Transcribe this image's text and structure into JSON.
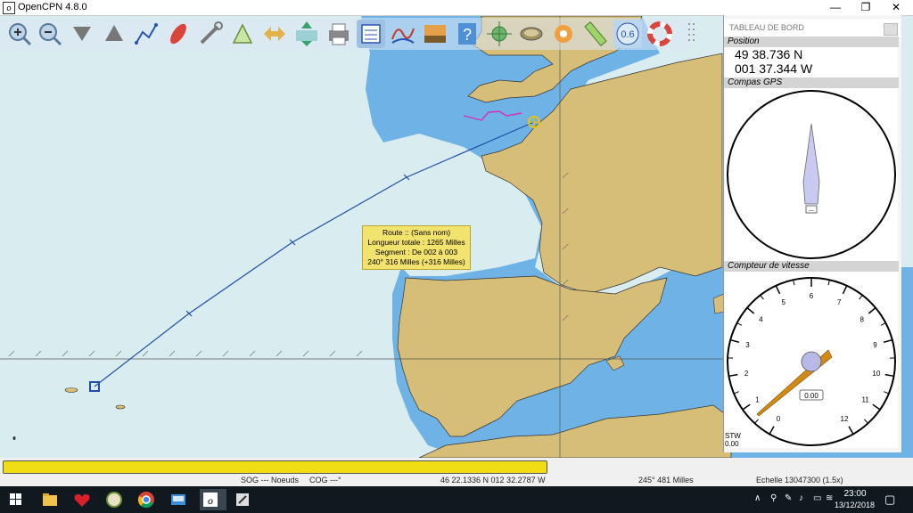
{
  "window": {
    "title": "OpenCPN 4.8.0",
    "min": "—",
    "restore": "❐",
    "close": "✕"
  },
  "toolbar": {
    "zoom_in": "zoom-in",
    "zoom_out": "zoom-out",
    "scale_out": "scale-out",
    "scale_in": "scale-in",
    "route": "route",
    "waypoint": "waypoint",
    "settings": "settings",
    "tracks": "tracks",
    "follow": "follow",
    "depth": "depth",
    "print": "print",
    "route_manager": "route-manager",
    "tides": "tides",
    "current": "current",
    "help": "help",
    "gps": "gps",
    "ais": "ais",
    "wave": "wave",
    "mob": "mob",
    "measure": "measure",
    "dist_value": "0.6",
    "lifebuoy": "lifebuoy"
  },
  "route_popup": {
    "line1": "Route :: (Sans nom)",
    "line2": "Longueur totale : 1265 Milles",
    "line3": "Segment : De 002 à 003",
    "line4": "240°  316 Milles (+316 Milles)"
  },
  "dashboard": {
    "title": "TABLEAU DE BORD",
    "position": {
      "label": "Position",
      "lat": "49 38.736 N",
      "lon": "001 37.344 W"
    },
    "compass": {
      "label": "Compas GPS",
      "cog": "---"
    },
    "speed": {
      "label": "Compteur de vitesse",
      "ticks": [
        "0",
        "1",
        "2",
        "3",
        "4",
        "5",
        "6",
        "7",
        "8",
        "9",
        "10",
        "11",
        "12"
      ],
      "value": "0.00",
      "stw_label": "STW",
      "stw_value": "0.00",
      "needle_value": 0.0
    }
  },
  "status": {
    "sog": "SOG --- Noeuds",
    "cog": "COG ---°",
    "cursor_position": "46 22.1336 N   012 32.2787 W",
    "bearing_distance": "245°  481 Milles",
    "scale": "Echelle 13047300 (1.5x)",
    "progress_pct": 100
  },
  "taskbar": {
    "clock_time": "23:00",
    "clock_date": "13/12/2018",
    "apps": [
      "start",
      "file-explorer",
      "heart-app",
      "globe-app",
      "chrome",
      "control-panel",
      "opencpn",
      "notes-app"
    ]
  },
  "colors": {
    "sea": "#d9ecef",
    "shelf": "#6fb3e6",
    "land": "#d6bd78",
    "route": "#1f4fa5",
    "popup": "#f2e36e",
    "progress": "#f1dd14"
  }
}
